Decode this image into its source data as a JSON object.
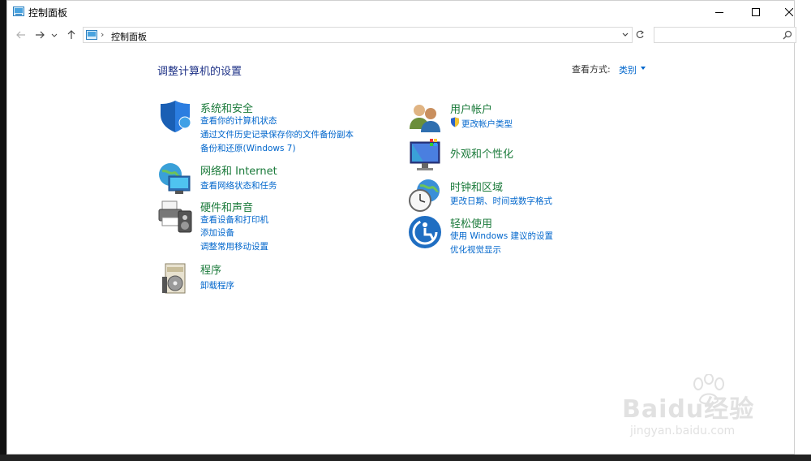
{
  "window": {
    "title": "控制面板"
  },
  "address": {
    "path_item": "控制面板",
    "separator": "›"
  },
  "search": {
    "placeholder": "",
    "value": ""
  },
  "main": {
    "heading": "调整计算机的设置",
    "view_by_label": "查看方式:",
    "view_by_value": "类别"
  },
  "categories": {
    "system": {
      "title": "系统和安全",
      "icon": "shield-icon",
      "links": [
        "查看你的计算机状态",
        "通过文件历史记录保存你的文件备份副本",
        "备份和还原(Windows 7)"
      ]
    },
    "network": {
      "title": "网络和 Internet",
      "icon": "network-globe-icon",
      "links": [
        "查看网络状态和任务"
      ]
    },
    "hardware": {
      "title": "硬件和声音",
      "icon": "printer-speaker-icon",
      "links": [
        "查看设备和打印机",
        "添加设备",
        "调整常用移动设置"
      ]
    },
    "programs": {
      "title": "程序",
      "icon": "programs-disk-icon",
      "links": [
        "卸载程序"
      ]
    },
    "users": {
      "title": "用户帐户",
      "icon": "users-icon",
      "links": [
        "更改帐户类型"
      ]
    },
    "appearance": {
      "title": "外观和个性化",
      "icon": "monitor-palette-icon",
      "links": []
    },
    "clock": {
      "title": "时钟和区域",
      "icon": "clock-globe-icon",
      "links": [
        "更改日期、时间或数字格式"
      ]
    },
    "ease": {
      "title": "轻松使用",
      "icon": "ease-of-access-icon",
      "links": [
        "使用 Windows 建议的设置",
        "优化视觉显示"
      ]
    }
  },
  "watermark": {
    "brand": "Baidu经验",
    "url": "jingyan.baidu.com"
  },
  "colors": {
    "link": "#0066cc",
    "category_title": "#1a7a3a",
    "heading": "#1e3287"
  }
}
